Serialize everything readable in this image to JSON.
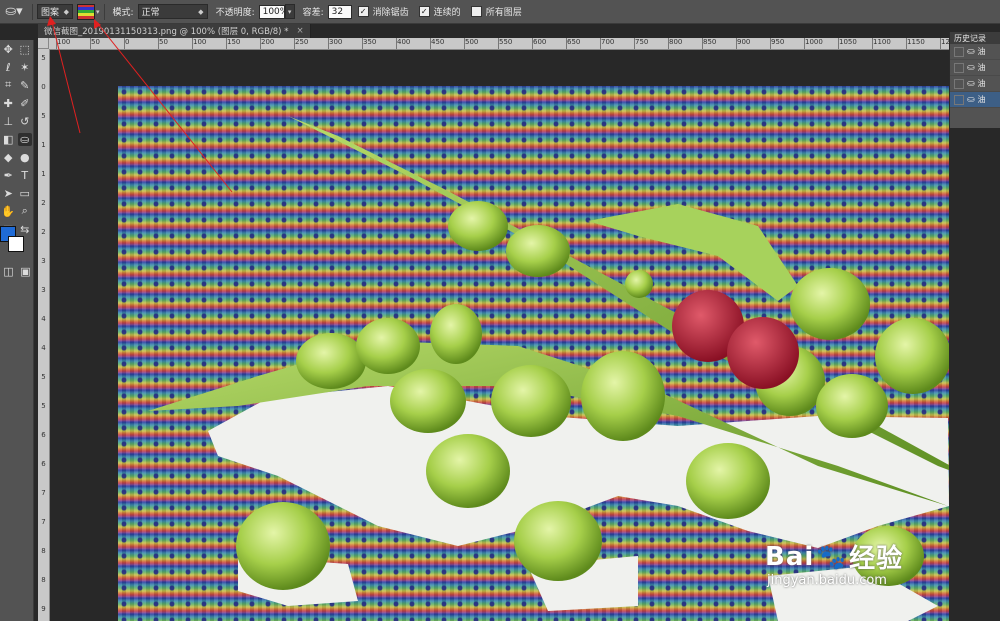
{
  "options_bar": {
    "tool_icon": "paint-bucket-icon",
    "fill_source": "图案",
    "mode_label": "模式:",
    "mode_value": "正常",
    "opacity_label": "不透明度:",
    "opacity_value": "100%",
    "tolerance_label": "容差:",
    "tolerance_value": "32",
    "antialias_label": "消除锯齿",
    "antialias_checked": true,
    "contiguous_label": "连续的",
    "contiguous_checked": true,
    "all_layers_label": "所有图层",
    "all_layers_checked": false
  },
  "document": {
    "tab_title": "微信截图_20190131150313.png @ 100% (图层 0, RGB/8) *",
    "tab_close": "×"
  },
  "ruler": {
    "h_ticks": [
      "100",
      "50",
      "0",
      "50",
      "100",
      "150",
      "200",
      "250",
      "300",
      "350",
      "400",
      "450",
      "500",
      "550",
      "600",
      "650",
      "700",
      "750",
      "800",
      "850",
      "900",
      "950",
      "1000",
      "1050",
      "1100",
      "1150",
      "1200"
    ],
    "v_ticks": [
      "5",
      "0",
      "5",
      "1",
      "1",
      "2",
      "2",
      "3",
      "3",
      "4",
      "4",
      "5",
      "5",
      "6",
      "6",
      "7",
      "7",
      "8",
      "8",
      "9"
    ]
  },
  "history_panel": {
    "title": "历史记录",
    "items": [
      {
        "label": "油"
      },
      {
        "label": "油"
      },
      {
        "label": "油"
      },
      {
        "label": "油"
      }
    ],
    "selected_index": 3
  },
  "colors": {
    "foreground": "#1f6bd6",
    "background": "#ffffff",
    "annotation": "#e02020"
  },
  "watermark": {
    "brand_left": "Bai",
    "brand_right": "经验",
    "url": "jingyan.baidu.com"
  }
}
